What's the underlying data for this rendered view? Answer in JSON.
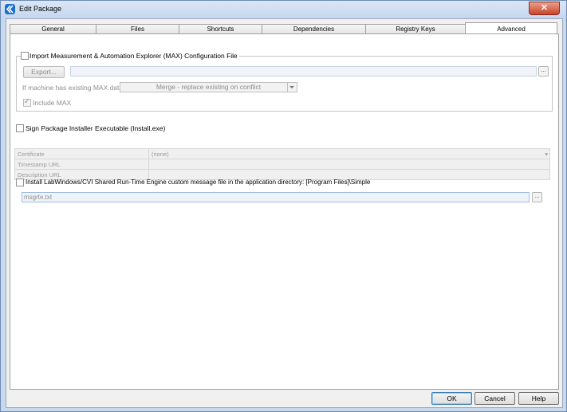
{
  "window": {
    "title": "Edit Package",
    "close_glyph": "✕"
  },
  "tabs": [
    {
      "label": "General"
    },
    {
      "label": "Files"
    },
    {
      "label": "Shortcuts"
    },
    {
      "label": "Dependencies"
    },
    {
      "label": "Registry Keys"
    },
    {
      "label": "Advanced"
    }
  ],
  "max_section": {
    "checkbox_label": "Import Measurement & Automation Explorer (MAX) Configuration File",
    "checked": false,
    "export_button": "Export...",
    "path_value": "",
    "browse_label": "...",
    "existing_label": "If machine has existing MAX data:",
    "existing_select": "Merge - replace existing on conflict",
    "include_label": "Include MAX",
    "include_checked": true
  },
  "sign_section": {
    "checkbox_label": "Sign Package Installer Executable (Install.exe)",
    "checked": false,
    "rows": [
      {
        "label": "Certificate",
        "value": "(none)"
      },
      {
        "label": "Timestamp URL",
        "value": ""
      },
      {
        "label": "Description URL",
        "value": ""
      }
    ]
  },
  "cvi_section": {
    "checkbox_label": "Install LabWindows/CVI Shared Run-Time Engine custom message file in the application directory: [Program Files]\\Simple",
    "checked": false,
    "file_value": "msgrte.txt",
    "browse_label": "..."
  },
  "footer": {
    "ok": "OK",
    "cancel": "Cancel",
    "help": "Help"
  }
}
